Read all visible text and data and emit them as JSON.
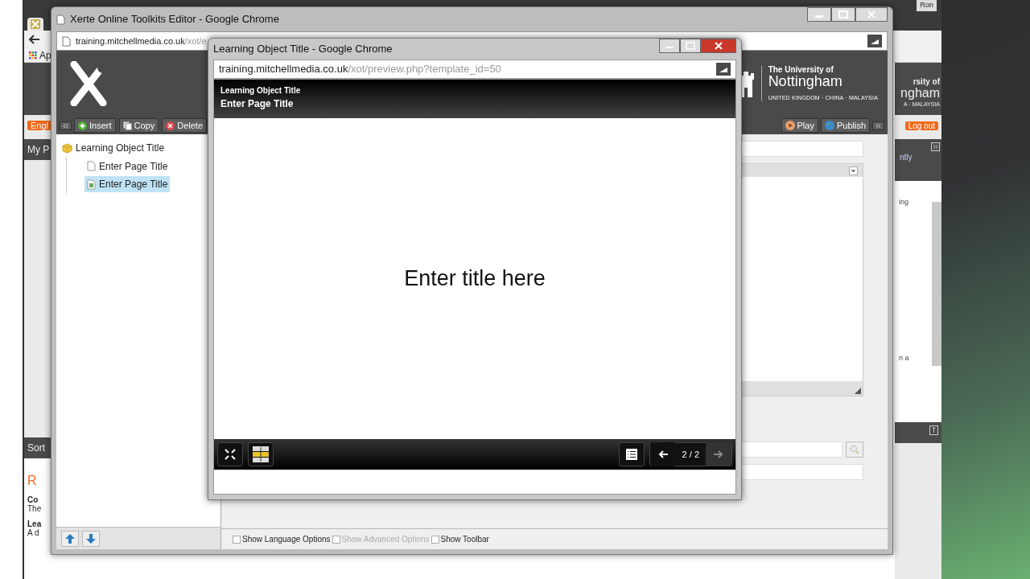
{
  "background_window": {
    "user": "Ron",
    "bookmarks": "Ap",
    "language": "Engl",
    "section": "My P",
    "sort": "Sort",
    "heading": "R",
    "line_1": "Co",
    "line_2": "The",
    "line_3": "Lea",
    "line_4": "A d",
    "logo_line_1": "rsity of",
    "logo_line_2": "ngham",
    "logo_line_3": "A · MALAYSIA",
    "logout": "Log out",
    "panel_text": "ntly",
    "list_text_1": "ing",
    "list_text_2": "n a"
  },
  "editor_window": {
    "title": "Xerte Online Toolkits Editor - Google Chrome",
    "url_host": "training.mitchellmedia.co.uk",
    "url_path": "/xot/e",
    "toolbar": [
      {
        "label": "Insert",
        "kind": "insert"
      },
      {
        "label": "Copy",
        "kind": "copy"
      },
      {
        "label": "Delete",
        "kind": "delete"
      }
    ],
    "tree": [
      {
        "label": "Learning Object Title",
        "kind": "project",
        "selected": false,
        "children": [
          {
            "label": "Enter Page Title",
            "kind": "page",
            "selected": false
          },
          {
            "label": "Enter Page Title",
            "kind": "page",
            "selected": true
          }
        ]
      }
    ],
    "logo": {
      "line_1": "The University of",
      "line_2": "Nottingham",
      "line_3": "UNITED KINGDOM · CHINA · MALAYSIA"
    },
    "actions": [
      {
        "label": "Play",
        "kind": "play"
      },
      {
        "label": "Publish",
        "kind": "publish"
      }
    ],
    "options": [
      {
        "label": "Show Language Options",
        "checked": false,
        "disabled": false
      },
      {
        "label": "Show Advanced Options",
        "checked": false,
        "disabled": true
      },
      {
        "label": "Show Toolbar",
        "checked": false,
        "disabled": false
      }
    ]
  },
  "preview_window": {
    "title": "Learning Object Title - Google Chrome",
    "url_host": "training.mitchellmedia.co.uk",
    "url_path": "/xot/preview.php?template_id=50",
    "project_title": "Learning Object Title",
    "page_title": "Enter Page Title",
    "content_title": "Enter title here",
    "page_counter": "2 / 2"
  }
}
